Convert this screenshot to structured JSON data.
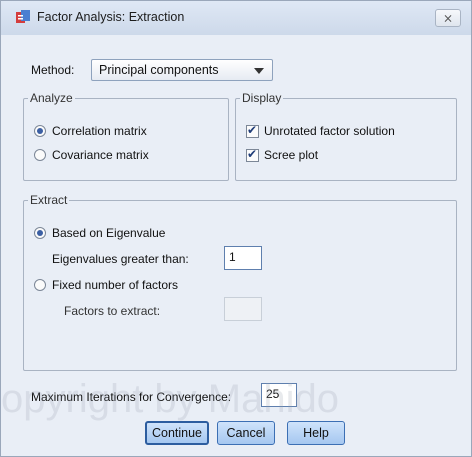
{
  "window": {
    "title": "Factor Analysis: Extraction",
    "close_label": "⨯"
  },
  "method": {
    "label": "Method:",
    "selected": "Principal components"
  },
  "analyze": {
    "legend": "Analyze",
    "options": [
      {
        "label": "Correlation matrix",
        "selected": true
      },
      {
        "label": "Covariance matrix",
        "selected": false
      }
    ]
  },
  "display": {
    "legend": "Display",
    "options": [
      {
        "label": "Unrotated factor solution",
        "checked": true
      },
      {
        "label": "Scree plot",
        "checked": true
      }
    ]
  },
  "extract": {
    "legend": "Extract",
    "based_on_eigenvalue": {
      "label": "Based on Eigenvalue",
      "selected": true
    },
    "eigen_label": "Eigenvalues greater than:",
    "eigen_value": "1",
    "fixed_number": {
      "label": "Fixed number of factors",
      "selected": false
    },
    "factors_label": "Factors to extract:",
    "factors_value": ""
  },
  "iterations": {
    "label": "Maximum Iterations for Convergence:",
    "value": "25"
  },
  "buttons": {
    "continue": "Continue",
    "cancel": "Cancel",
    "help": "Help"
  },
  "watermark": "opyright by Mahido"
}
